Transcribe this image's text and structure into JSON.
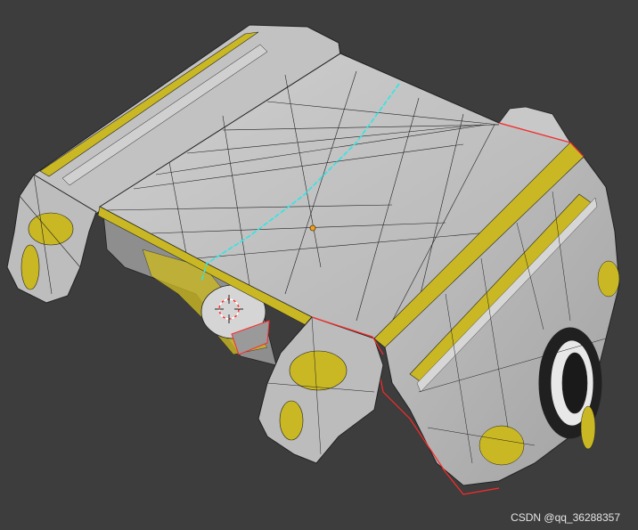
{
  "viewport": {
    "background": "#3d3d3d",
    "mesh_fill": "#b9b9b9",
    "mesh_fill_light": "#d1d1d1",
    "mesh_fill_dark": "#8e8e8e",
    "wire_color": "#222222",
    "uv_seam_color": "#2ee6e6",
    "sharp_edge_color": "#ff2a2a",
    "face_highlight_color": "#c9b823",
    "origin_color": "#f0a020",
    "cursor_icon": "3d-cursor-icon"
  },
  "watermark": {
    "text": "CSDN @qq_36288357"
  }
}
